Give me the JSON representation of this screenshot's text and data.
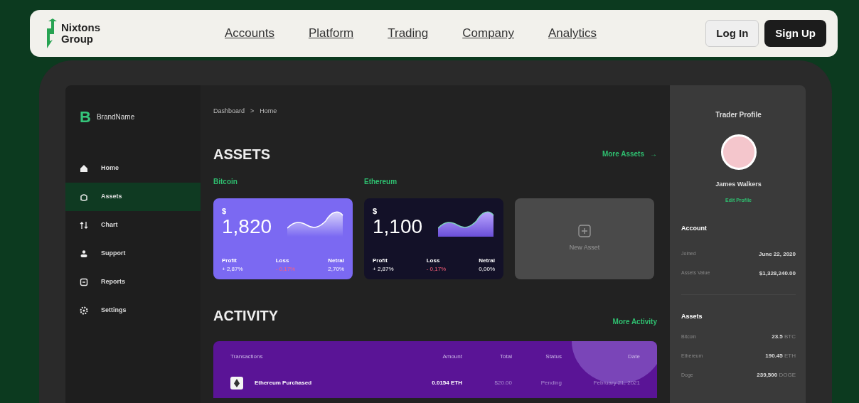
{
  "navbar": {
    "brand": [
      "Nixtons",
      "Group"
    ],
    "links": [
      {
        "label": "Accounts"
      },
      {
        "label": "Platform"
      },
      {
        "label": "Trading"
      },
      {
        "label": "Company"
      },
      {
        "label": "Analytics"
      }
    ],
    "login": "Log In",
    "signup": "Sign Up"
  },
  "sidebar": {
    "brand_letter": "B",
    "brand_name": "BrandName",
    "items": [
      {
        "label": "Home",
        "selected": false
      },
      {
        "label": "Assets",
        "selected": true
      },
      {
        "label": "Chart",
        "selected": false
      },
      {
        "label": "Support",
        "selected": false
      },
      {
        "label": "Reports",
        "selected": false
      },
      {
        "label": "Settings",
        "selected": false
      }
    ]
  },
  "breadcrumb": [
    "Dashboard",
    ">",
    "Home"
  ],
  "assets": {
    "title": "ASSETS",
    "more": "More Assets",
    "more_arrow": "→",
    "cards": [
      {
        "kind": "coin",
        "name": "Bitcoin",
        "currency": "$",
        "value": "1,820",
        "stats": [
          {
            "label": "Profit",
            "value": "+ 2,87%"
          },
          {
            "label": "Loss",
            "value": "- 0,17%"
          },
          {
            "label": "Netral",
            "value": "2,70%"
          }
        ]
      },
      {
        "kind": "coin",
        "name": "Ethereum",
        "currency": "$",
        "value": "1,100",
        "stats": [
          {
            "label": "Profit",
            "value": "+ 2,87%"
          },
          {
            "label": "Loss",
            "value": "- 0,17%"
          },
          {
            "label": "Netral",
            "value": "0,00%"
          }
        ]
      },
      {
        "kind": "add",
        "label": "New Asset"
      }
    ]
  },
  "activity": {
    "title": "ACTIVITY",
    "more": "More Activity",
    "columns": [
      "Transactions",
      "Amount",
      "Total",
      "Status",
      "Date"
    ],
    "rows": [
      {
        "transaction": "Ethereum Purchased",
        "amount": "0.0154 ETH",
        "total": "$20.00",
        "status": "Pending",
        "date": "February 21, 2021"
      }
    ]
  },
  "profile": {
    "title": "Trader Profile",
    "name": "James Walkers",
    "edit": "Edit Profile",
    "account_title": "Account",
    "account": [
      {
        "label": "Joined",
        "value": "June 22, 2020"
      },
      {
        "label": "Assets Value",
        "value": "$1,328,240.00"
      }
    ],
    "assets_title": "Assets",
    "assets": [
      {
        "label": "Bitcoin",
        "amount": "23.5",
        "unit": "BTC"
      },
      {
        "label": "Ethereum",
        "amount": "190.45",
        "unit": "ETH"
      },
      {
        "label": "Doge",
        "amount": "239,500",
        "unit": "DOGE"
      }
    ]
  }
}
